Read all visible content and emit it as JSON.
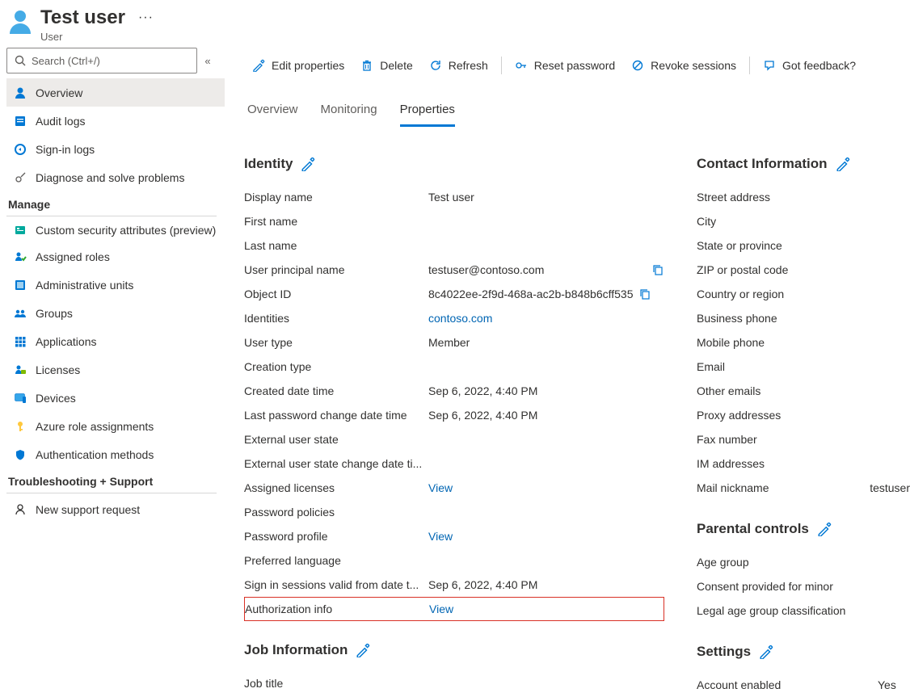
{
  "header": {
    "title": "Test user",
    "subtitle": "User"
  },
  "search": {
    "placeholder": "Search (Ctrl+/)"
  },
  "sidebar": {
    "top": [
      {
        "label": "Overview"
      },
      {
        "label": "Audit logs"
      },
      {
        "label": "Sign-in logs"
      },
      {
        "label": "Diagnose and solve problems"
      }
    ],
    "manage_title": "Manage",
    "manage": [
      {
        "label": "Custom security attributes (preview)"
      },
      {
        "label": "Assigned roles"
      },
      {
        "label": "Administrative units"
      },
      {
        "label": "Groups"
      },
      {
        "label": "Applications"
      },
      {
        "label": "Licenses"
      },
      {
        "label": "Devices"
      },
      {
        "label": "Azure role assignments"
      },
      {
        "label": "Authentication methods"
      }
    ],
    "ts_title": "Troubleshooting + Support",
    "ts": [
      {
        "label": "New support request"
      }
    ]
  },
  "toolbar": {
    "edit": "Edit properties",
    "delete": "Delete",
    "refresh": "Refresh",
    "reset": "Reset password",
    "revoke": "Revoke sessions",
    "feedback": "Got feedback?"
  },
  "tabs": {
    "overview": "Overview",
    "monitoring": "Monitoring",
    "properties": "Properties"
  },
  "identity": {
    "title": "Identity",
    "display_name_l": "Display name",
    "display_name_v": "Test user",
    "first_name_l": "First name",
    "first_name_v": "",
    "last_name_l": "Last name",
    "last_name_v": "",
    "upn_l": "User principal name",
    "upn_v": "testuser@contoso.com",
    "oid_l": "Object ID",
    "oid_v": "8c4022ee-2f9d-468a-ac2b-b848b6cff535",
    "identities_l": "Identities",
    "identities_v": "contoso.com",
    "user_type_l": "User type",
    "user_type_v": "Member",
    "creation_type_l": "Creation type",
    "creation_type_v": "",
    "created_l": "Created date time",
    "created_v": "Sep 6, 2022, 4:40 PM",
    "lastpw_l": "Last password change date time",
    "lastpw_v": "Sep 6, 2022, 4:40 PM",
    "ext_state_l": "External user state",
    "ext_state_v": "",
    "ext_state_date_l": "External user state change date ti...",
    "ext_state_date_v": "",
    "assigned_lic_l": "Assigned licenses",
    "assigned_lic_v": "View",
    "pw_policies_l": "Password policies",
    "pw_policies_v": "",
    "pw_profile_l": "Password profile",
    "pw_profile_v": "View",
    "pref_lang_l": "Preferred language",
    "pref_lang_v": "",
    "signin_valid_l": "Sign in sessions valid from date t...",
    "signin_valid_v": "Sep 6, 2022, 4:40 PM",
    "auth_info_l": "Authorization info",
    "auth_info_v": "View"
  },
  "job": {
    "title": "Job Information",
    "job_title_l": "Job title",
    "job_title_v": ""
  },
  "contact": {
    "title": "Contact Information",
    "street_l": "Street address",
    "city_l": "City",
    "state_l": "State or province",
    "zip_l": "ZIP or postal code",
    "country_l": "Country or region",
    "bphone_l": "Business phone",
    "mphone_l": "Mobile phone",
    "email_l": "Email",
    "oemails_l": "Other emails",
    "proxy_l": "Proxy addresses",
    "fax_l": "Fax number",
    "im_l": "IM addresses",
    "mailnick_l": "Mail nickname",
    "mailnick_v": "testuser"
  },
  "parental": {
    "title": "Parental controls",
    "age_l": "Age group",
    "consent_l": "Consent provided for minor",
    "legal_l": "Legal age group classification"
  },
  "settings": {
    "title": "Settings",
    "acct_enabled_l": "Account enabled",
    "acct_enabled_v": "Yes"
  }
}
